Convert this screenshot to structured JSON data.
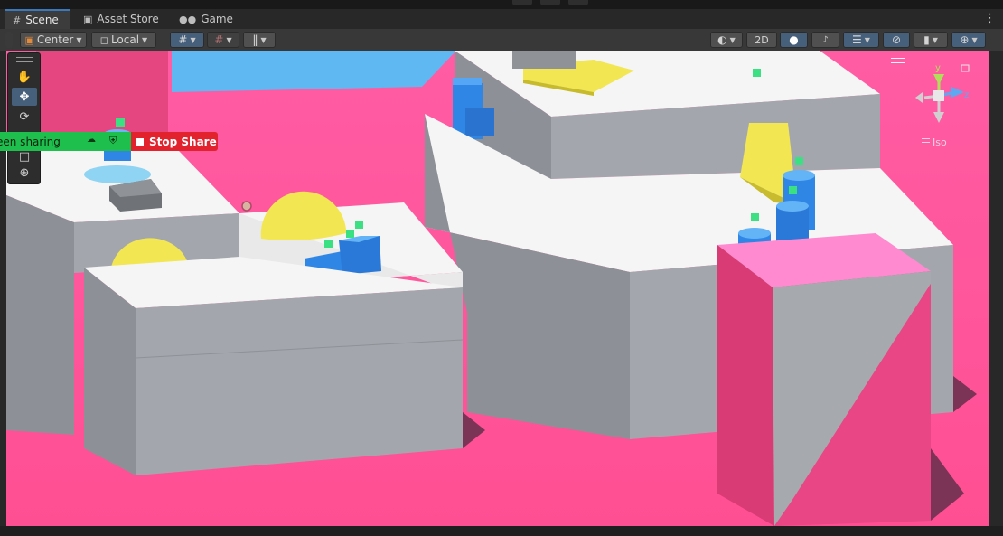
{
  "tabs": [
    {
      "label": "Scene",
      "icon": "scene-grid-icon",
      "active": true
    },
    {
      "label": "Asset Store",
      "icon": "asset-store-icon",
      "active": false
    },
    {
      "label": "Game",
      "icon": "gamepad-icon",
      "active": false
    }
  ],
  "toolbar": {
    "pivot_label": "Center",
    "space_label": "Local",
    "mode_2d_label": "2D"
  },
  "tool_palette": [
    {
      "name": "hand-tool",
      "icon": "hand-icon"
    },
    {
      "name": "move-tool",
      "icon": "move-icon",
      "active": true
    },
    {
      "name": "rotate-tool",
      "icon": "rotate-icon"
    },
    {
      "name": "scale-tool",
      "icon": "scale-icon"
    },
    {
      "name": "rect-tool",
      "icon": "rect-icon"
    },
    {
      "name": "transform-tool",
      "icon": "transform-icon"
    }
  ],
  "screen_share": {
    "status_label": "een sharing",
    "stop_label": "Stop Share"
  },
  "orientation_gizmo": {
    "axis_y": "y",
    "axis_z": "z",
    "projection_label": "Iso"
  },
  "colors": {
    "ground": "#ff58a2",
    "platform_top": "#f6f6f6",
    "platform_side": "#9da2a8",
    "accent_blue": "#3a79bb",
    "share_green": "#1fbf4e",
    "share_red": "#e2222d"
  }
}
